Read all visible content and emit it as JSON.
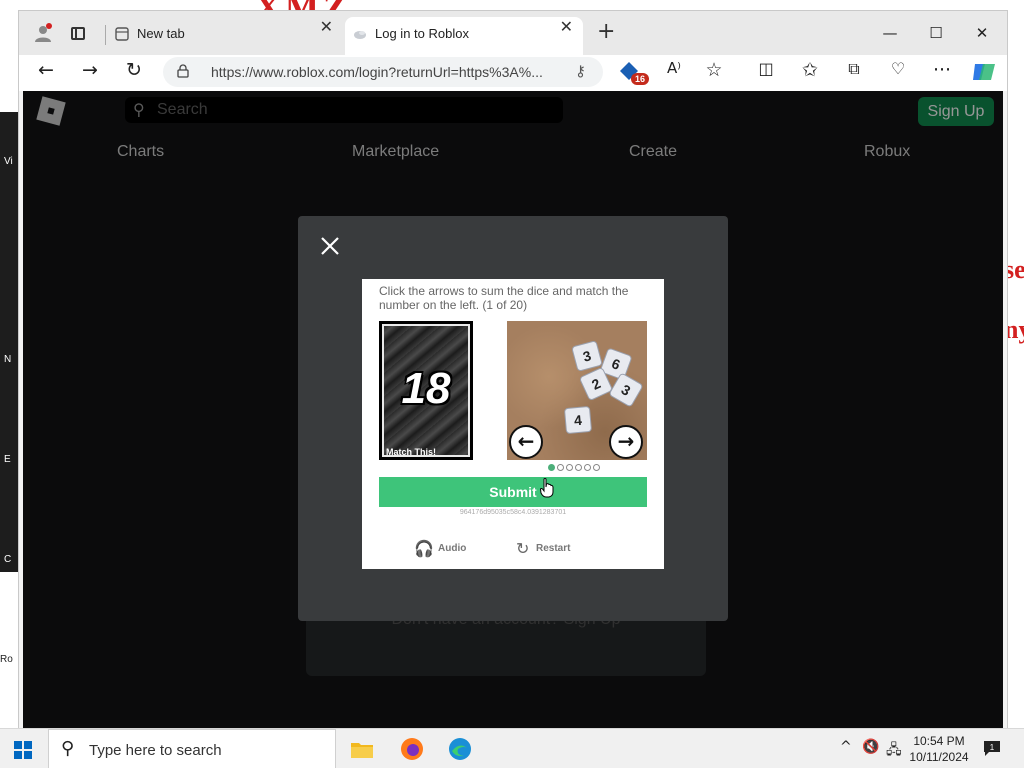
{
  "background": {
    "title_fragment": "XMZ",
    "right_fragment": "se ny",
    "left_labels": [
      "Vi",
      "N",
      "E",
      "C",
      "Ro"
    ]
  },
  "browser": {
    "tabs": [
      {
        "label": "New tab",
        "close": "✕"
      },
      {
        "label": "Log in to Roblox",
        "close": "✕"
      }
    ],
    "new_tab": "+",
    "window_controls": {
      "minimize": "—",
      "maximize": "☐",
      "close": "✕"
    },
    "toolbar": {
      "back": "←",
      "forward": "→",
      "refresh": "↻",
      "url": "https://www.roblox.com/login?returnUrl=https%3A%...",
      "extension_badge": "16",
      "read_aloud": "A⁾",
      "more": "···"
    }
  },
  "roblox": {
    "search_placeholder": "Search",
    "signup_label": "Sign Up",
    "nav": [
      "Charts",
      "Marketplace",
      "Create",
      "Robux"
    ],
    "footer_text": "Don't have an account? Sign Up"
  },
  "captcha": {
    "instruction": "Click the arrows to sum the dice and match the number on the left. (1 of 20)",
    "target_number": "18",
    "target_label": "Match This!",
    "dice": [
      "3",
      "6",
      "2",
      "3",
      "4"
    ],
    "arrow_left": "←",
    "arrow_right": "→",
    "page_dots": {
      "total": 6,
      "active": 0
    },
    "submit_label": "Submit",
    "session_id": "964176d95035c58c4.0391283701",
    "audio_label": "Audio",
    "restart_label": "Restart"
  },
  "taskbar": {
    "search_placeholder": "Type here to search",
    "time": "10:54 PM",
    "date": "10/11/2024",
    "notification_count": "1"
  },
  "colors": {
    "submit": "#3ec47a",
    "signup": "#0e7f48",
    "page_bg": "#111213",
    "modal_bg": "#393b3d"
  }
}
